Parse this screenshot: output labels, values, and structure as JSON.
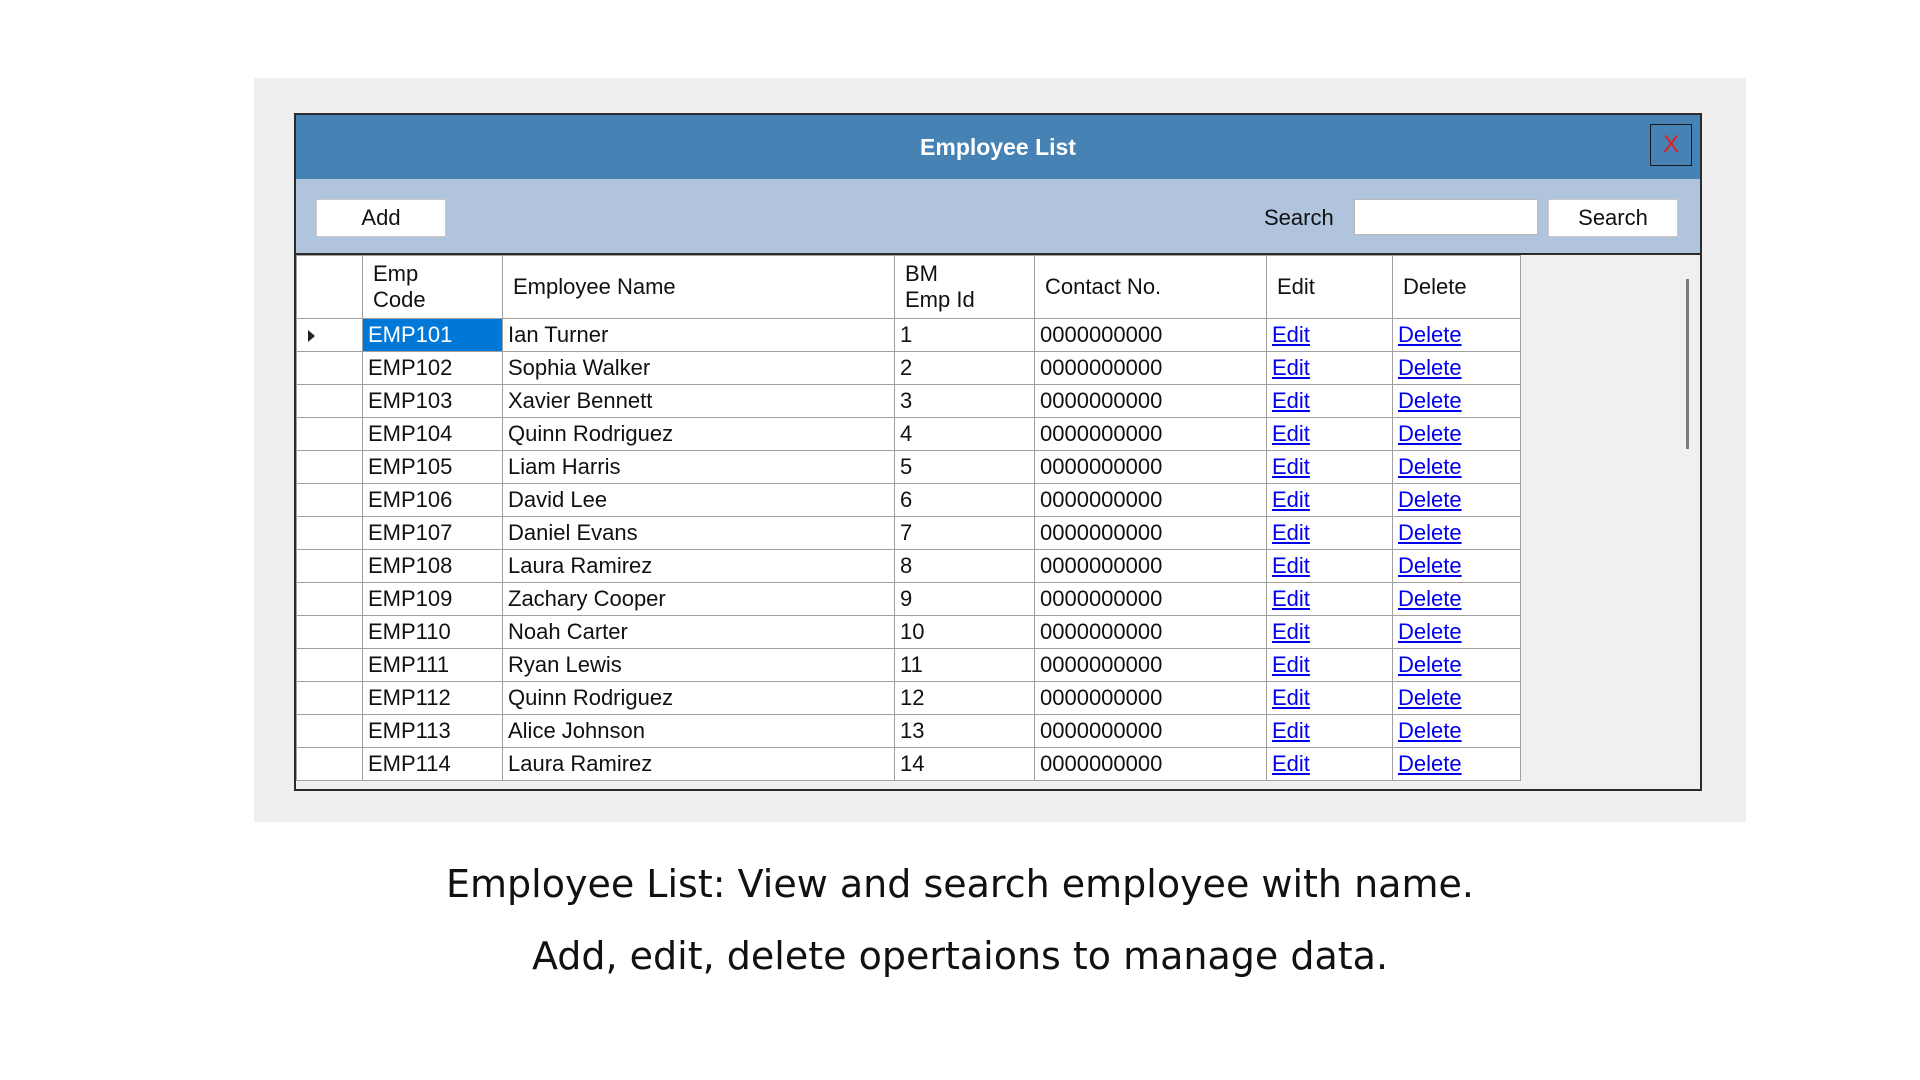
{
  "window": {
    "title": "Employee List",
    "close_label": "X"
  },
  "toolbar": {
    "add_label": "Add",
    "search_label": "Search",
    "search_value": "",
    "search_button": "Search"
  },
  "grid": {
    "columns": [
      "Emp\nCode",
      "Employee Name",
      "BM\nEmp Id",
      "Contact No.",
      "Edit",
      "Delete"
    ],
    "selected_row": 0,
    "rows": [
      {
        "code": "EMP101",
        "name": "Ian Turner",
        "bm_id": "1",
        "contact": "0000000000",
        "edit": "Edit",
        "delete": "Delete"
      },
      {
        "code": "EMP102",
        "name": "Sophia Walker",
        "bm_id": "2",
        "contact": "0000000000",
        "edit": "Edit",
        "delete": "Delete"
      },
      {
        "code": "EMP103",
        "name": "Xavier Bennett",
        "bm_id": "3",
        "contact": "0000000000",
        "edit": "Edit",
        "delete": "Delete"
      },
      {
        "code": "EMP104",
        "name": "Quinn Rodriguez",
        "bm_id": "4",
        "contact": "0000000000",
        "edit": "Edit",
        "delete": "Delete"
      },
      {
        "code": "EMP105",
        "name": "Liam Harris",
        "bm_id": "5",
        "contact": "0000000000",
        "edit": "Edit",
        "delete": "Delete"
      },
      {
        "code": "EMP106",
        "name": "David Lee",
        "bm_id": "6",
        "contact": "0000000000",
        "edit": "Edit",
        "delete": "Delete"
      },
      {
        "code": "EMP107",
        "name": "Daniel Evans",
        "bm_id": "7",
        "contact": "0000000000",
        "edit": "Edit",
        "delete": "Delete"
      },
      {
        "code": "EMP108",
        "name": "Laura Ramirez",
        "bm_id": "8",
        "contact": "0000000000",
        "edit": "Edit",
        "delete": "Delete"
      },
      {
        "code": "EMP109",
        "name": "Zachary Cooper",
        "bm_id": "9",
        "contact": "0000000000",
        "edit": "Edit",
        "delete": "Delete"
      },
      {
        "code": "EMP110",
        "name": "Noah Carter",
        "bm_id": "10",
        "contact": "0000000000",
        "edit": "Edit",
        "delete": "Delete"
      },
      {
        "code": "EMP111",
        "name": "Ryan Lewis",
        "bm_id": "11",
        "contact": "0000000000",
        "edit": "Edit",
        "delete": "Delete"
      },
      {
        "code": "EMP112",
        "name": "Quinn Rodriguez",
        "bm_id": "12",
        "contact": "0000000000",
        "edit": "Edit",
        "delete": "Delete"
      },
      {
        "code": "EMP113",
        "name": "Alice Johnson",
        "bm_id": "13",
        "contact": "0000000000",
        "edit": "Edit",
        "delete": "Delete"
      },
      {
        "code": "EMP114",
        "name": "Laura Ramirez",
        "bm_id": "14",
        "contact": "0000000000",
        "edit": "Edit",
        "delete": "Delete"
      }
    ]
  },
  "caption": {
    "line1": "Employee List: View and search employee with name.",
    "line2": "Add, edit, delete opertaions to manage data."
  },
  "colors": {
    "titlebar": "#4682b4",
    "toolbar": "#b0c4de",
    "selection": "#0078d7",
    "link": "#0000ee",
    "close_x": "#e02020"
  },
  "icons": {
    "row_indicator": "triangle-right-icon",
    "close": "close-icon"
  }
}
